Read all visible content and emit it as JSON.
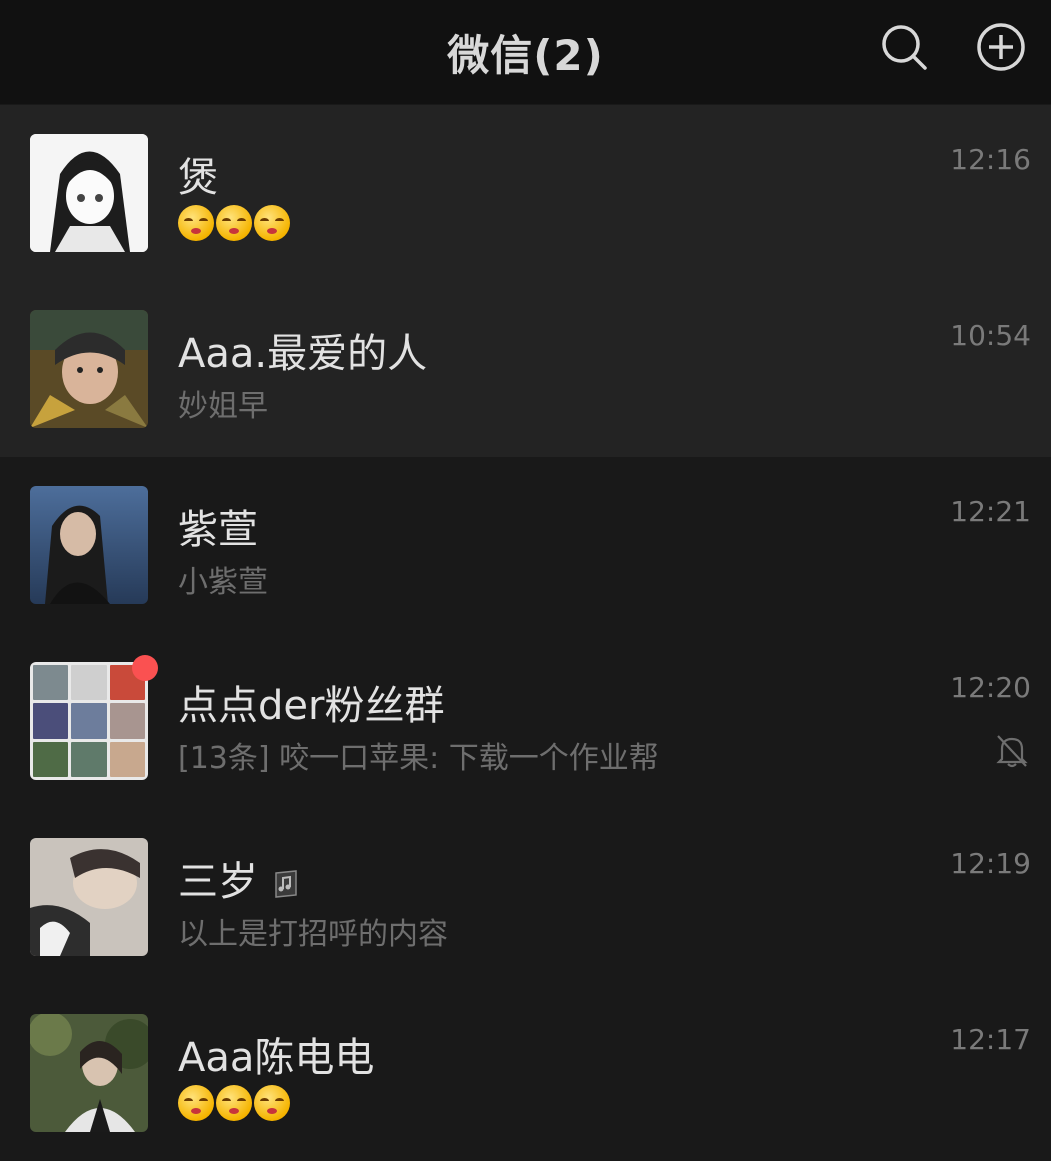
{
  "header": {
    "title": "微信(2)"
  },
  "chats": [
    {
      "name": "煲",
      "preview_text": "",
      "preview_emoji_count": 3,
      "time": "12:16",
      "pinned": true
    },
    {
      "name": "Aaa.最爱的人",
      "preview_text": "妙姐早",
      "time": "10:54",
      "pinned": true
    },
    {
      "name": "紫萱",
      "preview_text": "小紫萱",
      "time": "12:21",
      "pinned": false
    },
    {
      "name": "点点der粉丝群",
      "preview_text": "[13条] 咬一口苹果: 下载一个作业帮",
      "time": "12:20",
      "pinned": false,
      "unread_dot": true,
      "muted": true
    },
    {
      "name": "三岁",
      "preview_text": "以上是打招呼的内容",
      "time": "12:19",
      "pinned": false,
      "status_icon": "music-status-icon"
    },
    {
      "name": "Aaa陈电电",
      "preview_text": "",
      "preview_emoji_count": 3,
      "time": "12:17",
      "pinned": false
    }
  ],
  "colors": {
    "header_bg": "#111111",
    "list_bg": "#191919",
    "pinned_bg": "#232323",
    "badge": "#fa5151"
  },
  "icons": {
    "search": "search-icon",
    "add": "add-circle-icon",
    "mute": "bell-muted-icon"
  }
}
